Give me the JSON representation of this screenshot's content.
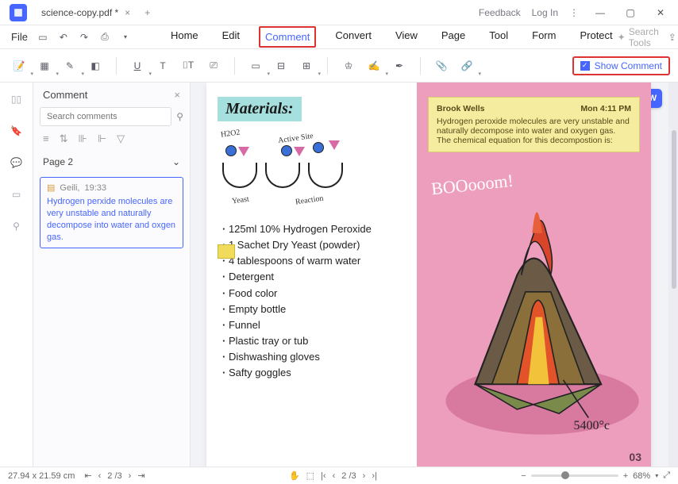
{
  "title": {
    "tab": "science-copy.pdf *",
    "feedback": "Feedback",
    "login": "Log In"
  },
  "menu": {
    "file": "File",
    "items": [
      "Home",
      "Edit",
      "Comment",
      "Convert",
      "View",
      "Page",
      "Tool",
      "Form",
      "Protect"
    ],
    "active_index": 2,
    "search_tools": "Search Tools"
  },
  "ribbon": {
    "show_comment": "Show Comment"
  },
  "comment_panel": {
    "title": "Comment",
    "search_placeholder": "Search comments",
    "page_label": "Page 2",
    "card": {
      "author": "Geili,",
      "time": "19:33",
      "text": "Hydrogen perxide molecules are very unstable and naturally decompose into water and oxgen gas."
    }
  },
  "document": {
    "materials_heading": "Materials:",
    "labels": {
      "h2o2": "H2O2",
      "active_site": "Active Site",
      "yeast": "Yeast",
      "reaction": "Reaction"
    },
    "list": [
      "125ml 10% Hydrogen Peroxide",
      "1 Sachet Dry Yeast (powder)",
      "4 tablespoons of warm water",
      "Detergent",
      "Food color",
      "Empty bottle",
      "Funnel",
      "Plastic tray or tub",
      "Dishwashing gloves",
      "Safty goggles"
    ],
    "sticky": {
      "author": "Brook Wells",
      "time": "Mon 4:11 PM",
      "body": "Hydrogen peroxide molecules are very unstable and naturally decompose into water and oxygen gas. The chemical equation for this decompostion is:"
    },
    "boom": "BOOooom!",
    "temp": "5400°c",
    "pagenum": "03"
  },
  "status": {
    "dims": "27.94 x 21.59 cm",
    "page": "2 /3",
    "zoom": "68%",
    "fit": "⤢"
  }
}
